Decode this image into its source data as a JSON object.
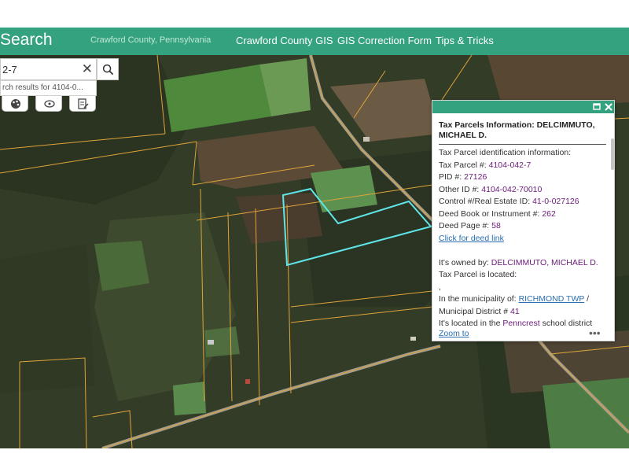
{
  "header": {
    "title": "Search",
    "subtitle": "Crawford County, Pennsylvania",
    "nav": [
      "Crawford County GIS",
      "GIS Correction Form",
      "Tips & Tricks"
    ],
    "bg_color": "#35a27f"
  },
  "search": {
    "value": "2-7",
    "suggestion": "rch results for 4104-0..."
  },
  "popup": {
    "title": "Tax Parcels Information: DELCIMMUTO, MICHAEL D.",
    "lines": {
      "intro": "Tax Parcel identification information:",
      "parcel_label": "Tax Parcel #: ",
      "parcel_value": "4104-042-7",
      "pid_label": "PID #: ",
      "pid_value": "27126",
      "other_label": "Other ID #: ",
      "other_value": "4104-042-70010",
      "control_label": "Control #/Real Estate ID: ",
      "control_value": "41-0-027126",
      "deedbook_label": "Deed Book or Instrument #: ",
      "deedbook_value": "262",
      "deedpage_label": "Deed Page #: ",
      "deedpage_value": "58",
      "deed_link": "Click for deed link",
      "owner_label": "It's owned by: ",
      "owner_value": "DELCIMMUTO, MICHAEL D.",
      "located_label": "Tax Parcel is located:",
      "comma": ",",
      "muni_label": "In the municipality of: ",
      "muni_value": "RICHMOND TWP",
      "muni_suffix": " /",
      "district_label": "Municipal District # ",
      "district_value": "41",
      "school_label": "It's located in the ",
      "school_value": "Penncrest",
      "school_suffix": " school district"
    },
    "zoom_to": "Zoom to",
    "more": "•••"
  },
  "map": {
    "parcel_highlight_color": "#5fe6ea",
    "parcel_line_color": "#e0a43a"
  }
}
